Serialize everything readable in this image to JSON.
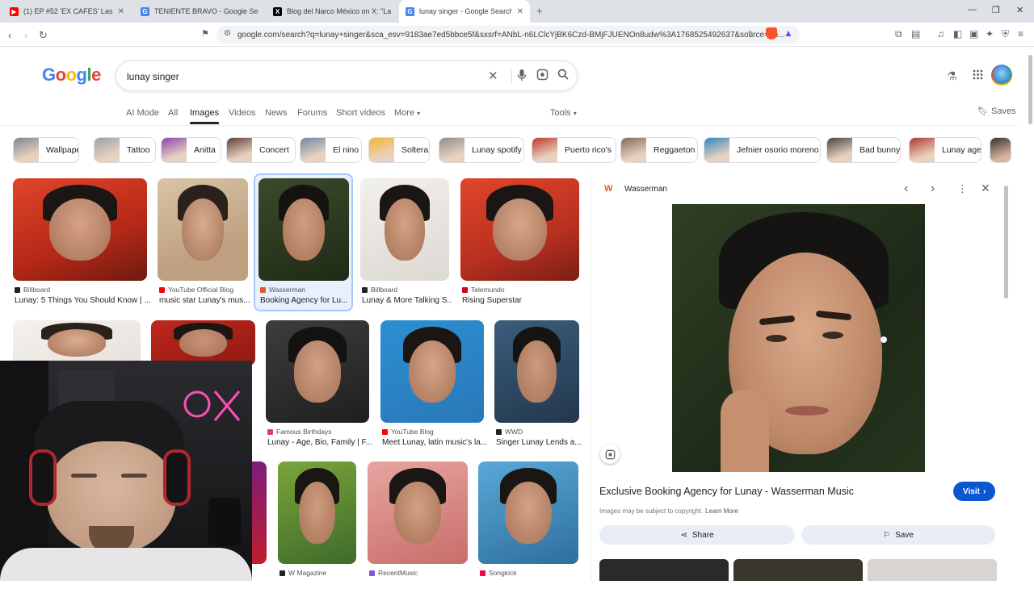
{
  "browser": {
    "tabs": [
      {
        "title": "(1) EP #52 'EX CAFES' Las FUERZ",
        "color": "#ff0000",
        "glyph": "▶"
      },
      {
        "title": "TENIENTE BRAVO - Google Search",
        "color": "#4285f4",
        "glyph": "G"
      },
      {
        "title": "Blog del Narco México on X: \"La histo",
        "color": "#000000",
        "glyph": "X"
      },
      {
        "title": "lunay singer - Google Search",
        "color": "#4285f4",
        "glyph": "G"
      }
    ],
    "url": "google.com/search?q=lunay+singer&sca_esv=9183ae7ed5bbce5f&sxsrf=ANbL-n6LClcYjBK6Czd-BMjFJUENOn8udw%3A1768525492637&source=hp...",
    "new_tab": "+",
    "minimize": "—",
    "maximize": "❐",
    "close": "✕"
  },
  "google": {
    "logo": [
      {
        "ch": "G",
        "color": "#4285f4"
      },
      {
        "ch": "o",
        "color": "#ea4335"
      },
      {
        "ch": "o",
        "color": "#fbbc05"
      },
      {
        "ch": "g",
        "color": "#4285f4"
      },
      {
        "ch": "l",
        "color": "#34a853"
      },
      {
        "ch": "e",
        "color": "#ea4335"
      }
    ],
    "query": "lunay singer",
    "tabs": [
      "AI Mode",
      "All",
      "Images",
      "Videos",
      "News",
      "Forums",
      "Short videos",
      "More"
    ],
    "tools": "Tools",
    "saves": "Saves"
  },
  "chips": [
    "Wallpaper",
    "Tattoo",
    "Anitta",
    "Concert",
    "El nino",
    "Soltera",
    "Lunay spotify",
    "Puerto rico's",
    "Reggaeton",
    "Jefnier osorio moreno",
    "Bad bunny",
    "Lunay age"
  ],
  "results": {
    "row1": [
      {
        "source": "Billboard",
        "title": "Lunay: 5 Things You Should Know | ...",
        "fav": "#222222"
      },
      {
        "source": "YouTube Official Blog",
        "title": "music star Lunay's mus...",
        "fav": "#ff0000"
      },
      {
        "source": "Wasserman",
        "title": "Booking Agency for Lu...",
        "fav": "#e05a2b"
      },
      {
        "source": "Billboard",
        "title": "Lunay & More Talking S...",
        "fav": "#222222"
      },
      {
        "source": "Telemundo",
        "title": "Rising Superstar",
        "fav": "#d0021b"
      }
    ],
    "row2": [
      {
        "source": "Famous Birthdays",
        "title": "Lunay - Age, Bio, Family | F...",
        "fav": "#e3377b"
      },
      {
        "source": "YouTube Blog",
        "title": "Meet Lunay, latin music's la...",
        "fav": "#ff0000"
      },
      {
        "source": "WWD",
        "title": "Singer Lunay Lends a...",
        "fav": "#222222"
      }
    ],
    "row3": [
      {
        "source": "W Magazine",
        "fav": "#222222"
      },
      {
        "source": "RecentMusic",
        "fav": "#7b5cd6"
      },
      {
        "source": "Songkick",
        "fav": "#f80046"
      }
    ]
  },
  "panel": {
    "source": "Wasserman",
    "title": "Exclusive Booking Agency for Lunay - Wasserman Music",
    "visit": "Visit",
    "copyright": "Images may be subject to copyright.",
    "learn_more": "Learn More",
    "share": "Share",
    "save": "Save"
  },
  "cam": {
    "neon": "ox"
  }
}
